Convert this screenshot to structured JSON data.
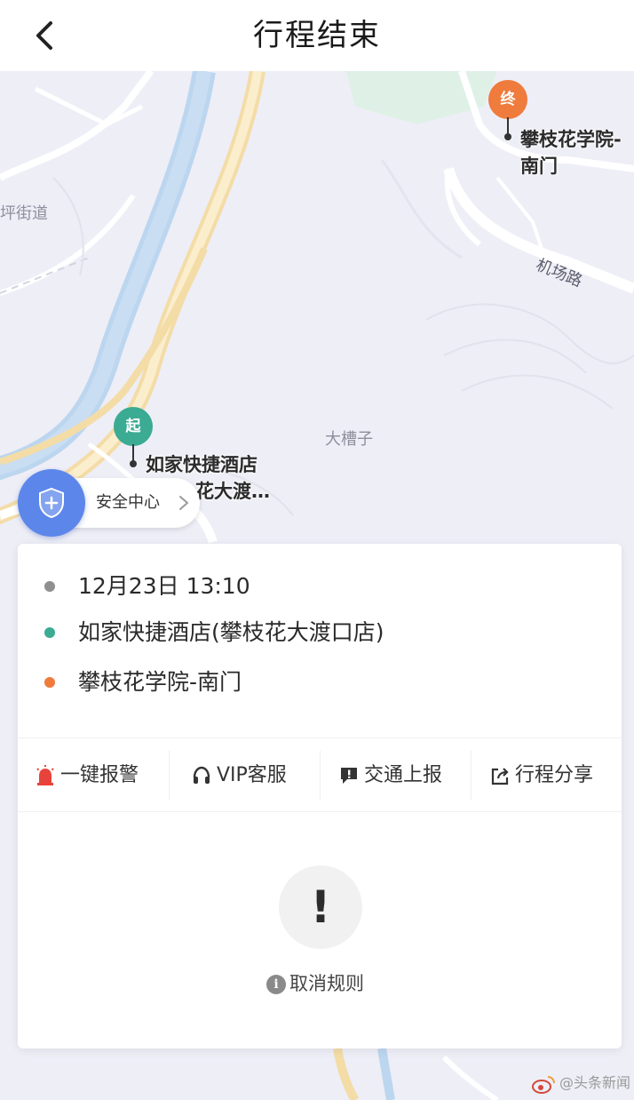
{
  "navbar": {
    "title": "行程结束",
    "back_icon": "chevron-left-icon"
  },
  "map": {
    "labels": {
      "street_fragment": "坪街道",
      "road_airport": "机场路",
      "area": "大槽子"
    },
    "start_pin": {
      "glyph": "起",
      "name_line1": "如家快捷酒店",
      "name_line2": "花大渡…",
      "color": "#3bab93"
    },
    "end_pin": {
      "glyph": "终",
      "name_line1": "攀枝花学院-",
      "name_line2": "南门",
      "color": "#ef7b3d"
    }
  },
  "safety_center": {
    "label": "安全中心",
    "icon": "shield-plus-icon",
    "color": "#5c86ea"
  },
  "trip": {
    "time": "12月23日 13:10",
    "origin": "如家快捷酒店(攀枝花大渡口店)",
    "destination": "攀枝花学院-南门",
    "time_dot_color": "#8f8f8f",
    "origin_dot_color": "#3bab93",
    "destination_dot_color": "#ef7b3d"
  },
  "actions": [
    {
      "label": "一键报警",
      "icon": "alarm-siren-icon"
    },
    {
      "label": "VIP客服",
      "icon": "headset-icon"
    },
    {
      "label": "交通上报",
      "icon": "report-flag-icon"
    },
    {
      "label": "行程分享",
      "icon": "share-icon"
    }
  ],
  "notice": {
    "glyph": "!",
    "cancel_rule_label": "取消规则",
    "info_glyph": "i"
  },
  "watermark": {
    "text": "@头条新闻"
  }
}
